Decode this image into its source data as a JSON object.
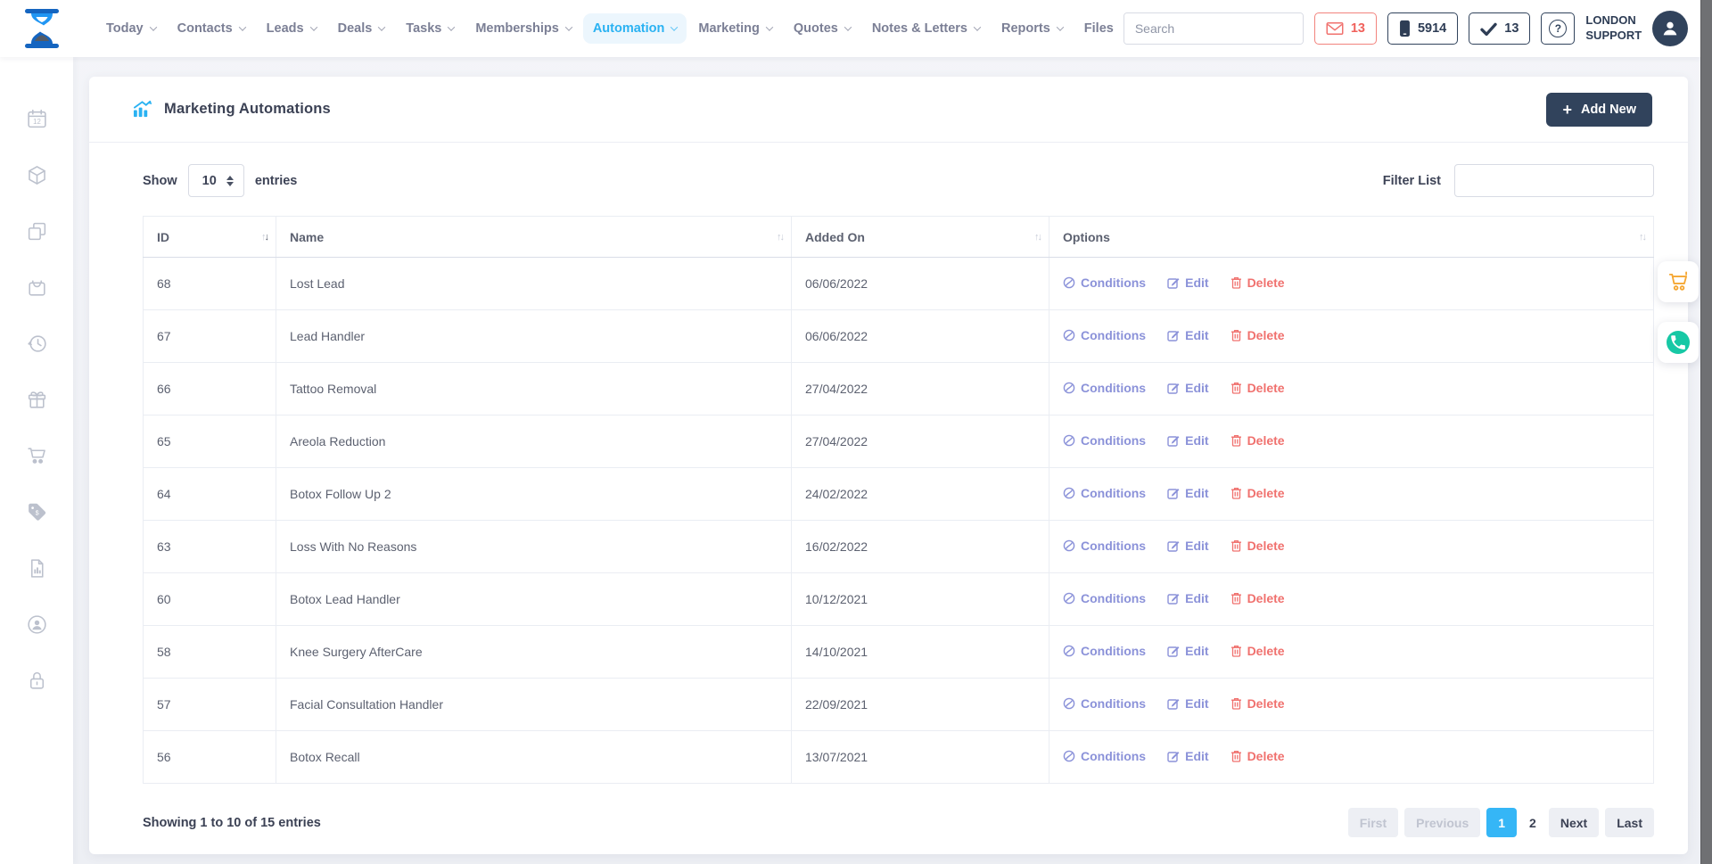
{
  "nav": {
    "items": [
      {
        "label": "Today",
        "dropdown": true,
        "active": false
      },
      {
        "label": "Contacts",
        "dropdown": true,
        "active": false
      },
      {
        "label": "Leads",
        "dropdown": true,
        "active": false
      },
      {
        "label": "Deals",
        "dropdown": true,
        "active": false
      },
      {
        "label": "Tasks",
        "dropdown": true,
        "active": false
      },
      {
        "label": "Memberships",
        "dropdown": true,
        "active": false
      },
      {
        "label": "Automation",
        "dropdown": true,
        "active": true
      },
      {
        "label": "Marketing",
        "dropdown": true,
        "active": false
      },
      {
        "label": "Quotes",
        "dropdown": true,
        "active": false
      },
      {
        "label": "Notes & Letters",
        "dropdown": true,
        "active": false
      },
      {
        "label": "Reports",
        "dropdown": true,
        "active": false
      },
      {
        "label": "Files",
        "dropdown": false,
        "active": false
      }
    ]
  },
  "topbar": {
    "search_placeholder": "Search",
    "mail_count": "13",
    "phone_count": "5914",
    "check_count": "13",
    "account_line1": "LONDON",
    "account_line2": "SUPPORT"
  },
  "sidebar": {
    "icons": [
      "calendar-12",
      "cube",
      "pages",
      "shopping-bag",
      "history",
      "gift",
      "cart",
      "price-tag",
      "report-chart",
      "user-circle",
      "lock"
    ]
  },
  "page": {
    "title": "Marketing Automations",
    "add_new_label": "Add New",
    "show_label": "Show",
    "page_size": "10",
    "entries_label": "entries",
    "filter_label": "Filter List",
    "filter_value": ""
  },
  "table": {
    "columns": [
      "ID",
      "Name",
      "Added On",
      "Options"
    ],
    "actions": {
      "conditions": "Conditions",
      "edit": "Edit",
      "delete": "Delete"
    },
    "rows": [
      {
        "id": "68",
        "name": "Lost Lead",
        "added_on": "06/06/2022"
      },
      {
        "id": "67",
        "name": "Lead Handler",
        "added_on": "06/06/2022"
      },
      {
        "id": "66",
        "name": "Tattoo Removal",
        "added_on": "27/04/2022"
      },
      {
        "id": "65",
        "name": "Areola Reduction",
        "added_on": "27/04/2022"
      },
      {
        "id": "64",
        "name": "Botox Follow Up 2",
        "added_on": "24/02/2022"
      },
      {
        "id": "63",
        "name": "Loss With No Reasons",
        "added_on": "16/02/2022"
      },
      {
        "id": "60",
        "name": "Botox Lead Handler",
        "added_on": "10/12/2021"
      },
      {
        "id": "58",
        "name": "Knee Surgery AfterCare",
        "added_on": "14/10/2021"
      },
      {
        "id": "57",
        "name": "Facial Consultation Handler",
        "added_on": "22/09/2021"
      },
      {
        "id": "56",
        "name": "Botox Recall",
        "added_on": "13/07/2021"
      }
    ],
    "summary": "Showing 1 to 10 of 15 entries",
    "pagination": {
      "first": "First",
      "previous": "Previous",
      "page1": "1",
      "page2": "2",
      "next": "Next",
      "last": "Last"
    }
  },
  "colors": {
    "accent_blue": "#2ab2f2",
    "navy": "#31435c",
    "link_purple": "#8b92d9",
    "danger_red": "#f0716e",
    "cart_orange": "#f5a733",
    "phone_teal": "#17c8a5",
    "pagination_active": "#35b6f6"
  }
}
